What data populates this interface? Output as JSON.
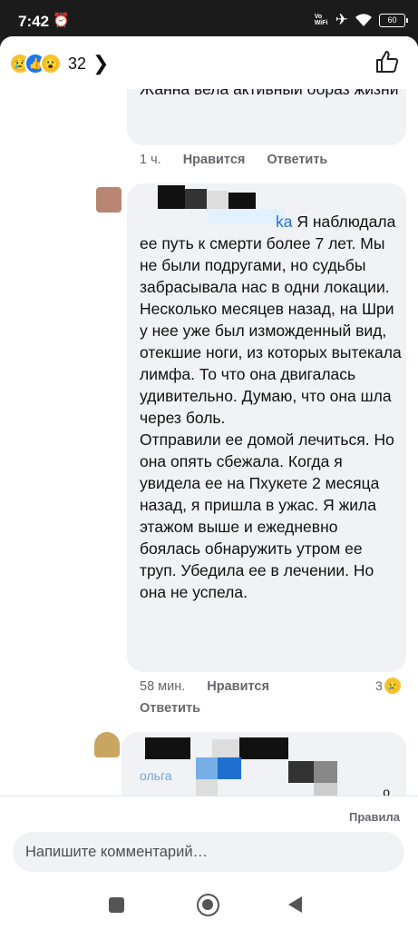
{
  "status_bar": {
    "time": "7:42",
    "alarm_icon": "alarm-icon",
    "vowifi": "Vo WiFi",
    "airplane_icon": "airplane-icon",
    "wifi_icon": "wifi-icon",
    "battery": "60"
  },
  "header": {
    "reactions": [
      "sad",
      "like",
      "wow"
    ],
    "reaction_count": "32",
    "chevron": "❯",
    "like_icon": "thumbs-up-icon"
  },
  "comments": [
    {
      "text": "ресел Долгие годы сыроедения Жанна вела активный образ жизни",
      "time": "1 ч.",
      "like_label": "Нравится",
      "reply_label": "Ответить"
    },
    {
      "name_visible": "ka",
      "text": " Я наблюдала ее путь к смерти более 7 лет. Мы не были подругами, но судьбы забрасывала нас в одни локации. Несколько месяцев назад, на Шри у нее уже был изможденный вид, отекшие ноги, из которых вытекала лимфа. То что она двигалась удивительно. Думаю, что она шла через боль.\nОтправили ее домой лечиться. Но она опять сбежала. Когда я увидела ее на Пхукете 2 месяца назад, я пришла в ужас. Я жила этажом выше и ежедневно боялась обнаружить утром ее труп. Убедила ее в лечении. Но она не успела.",
      "time": "58 мин.",
      "like_label": "Нравится",
      "reply_label": "Ответить",
      "reaction_count": "3"
    },
    {
      "name_visible": "ольга",
      "trailing": "о"
    }
  ],
  "rules_link": "Правила",
  "composer": {
    "placeholder": "Напишите комментарий…"
  },
  "colors": {
    "bubble": "#f0f2f5",
    "meta_text": "#65676b",
    "link_blue": "#216fdb",
    "reaction_yellow": "#f7c431",
    "like_blue": "#1877f2"
  }
}
